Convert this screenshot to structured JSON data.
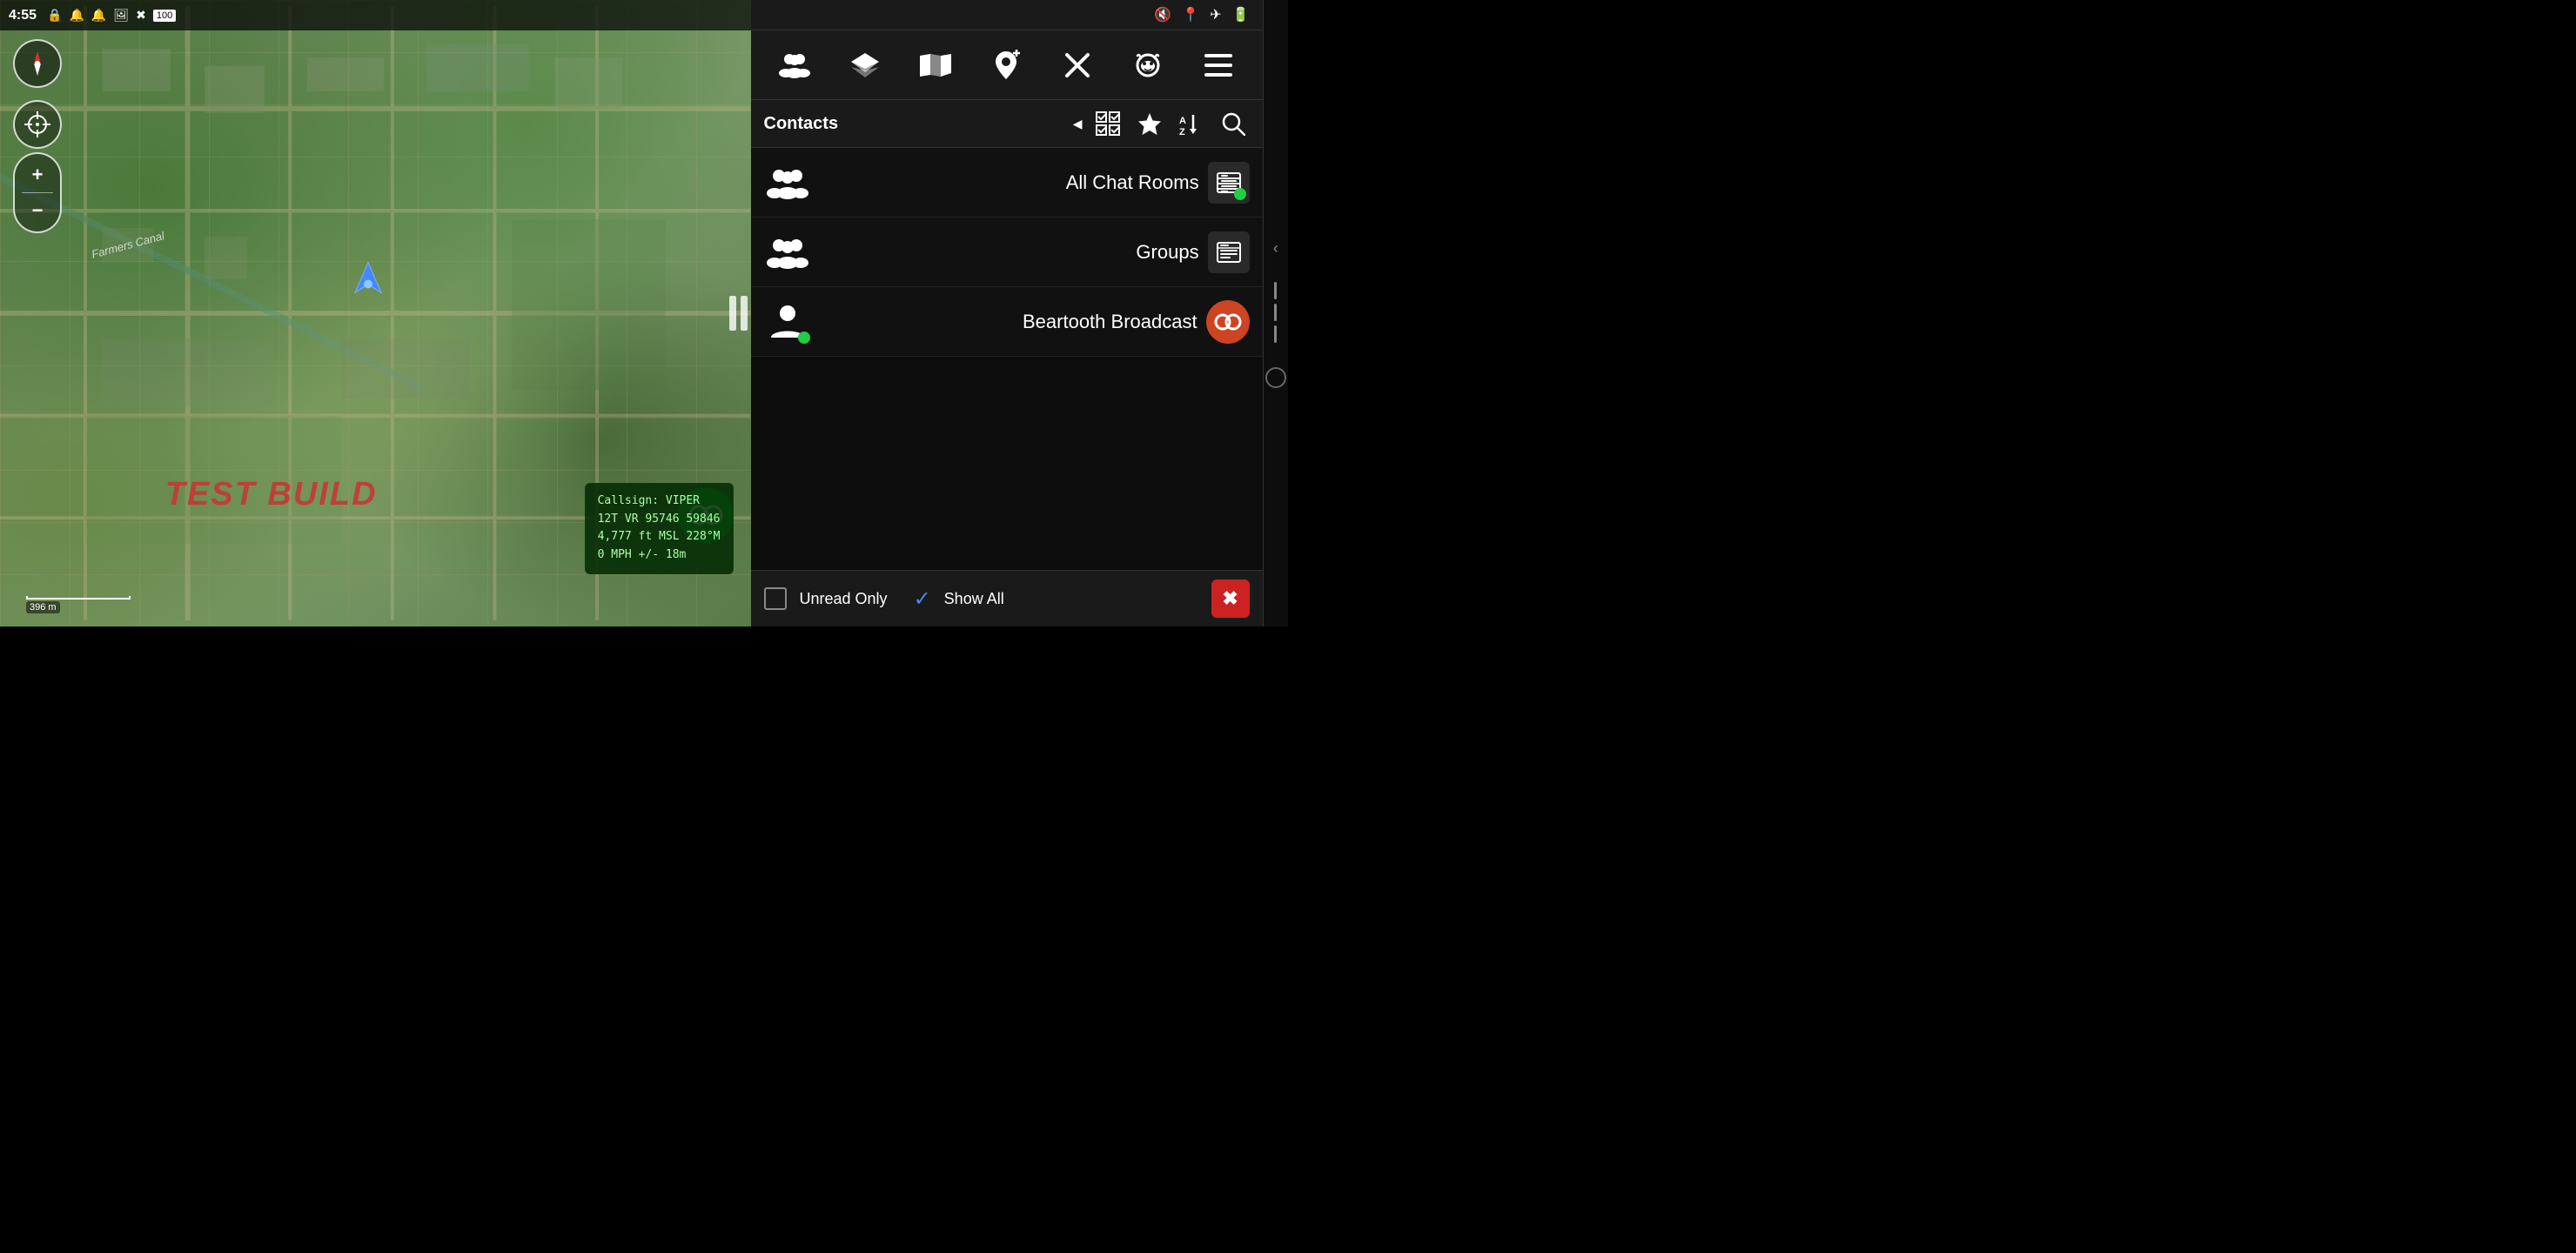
{
  "statusBar": {
    "time": "4:55",
    "icons": [
      "🔔",
      "🔔",
      "🖼",
      "✖",
      "🔋"
    ]
  },
  "statusBarRight": {
    "icons": [
      "🔇",
      "📍",
      "✈",
      "🔋"
    ]
  },
  "map": {
    "farmersCanal": "Farmers Canal",
    "testBuild": "TEST BUILD",
    "scaleLabel": "396 m",
    "callsign": {
      "line1": "Callsign: VIPER",
      "line2": "12T  VR  95746  59846",
      "line3": "4,777 ft MSL      228°M",
      "line4": "0 MPH            +/- 18m"
    }
  },
  "toolbar": {
    "icons": [
      {
        "name": "people-icon",
        "symbol": "👥"
      },
      {
        "name": "layers-icon",
        "symbol": "◈"
      },
      {
        "name": "map-icon",
        "symbol": "🗺"
      },
      {
        "name": "location-add-icon",
        "symbol": "📍"
      },
      {
        "name": "close-icon",
        "symbol": "✖"
      },
      {
        "name": "dog-icon",
        "symbol": "🐕"
      },
      {
        "name": "menu-icon",
        "symbol": "≡"
      }
    ]
  },
  "contactsHeader": {
    "title": "Contacts",
    "arrow": "◀"
  },
  "contacts": [
    {
      "name": "All Chat Rooms",
      "hasGreenDot": true,
      "actionIcon": "chat-rooms-icon"
    },
    {
      "name": "Groups",
      "hasGreenDot": false,
      "actionIcon": "groups-icon"
    },
    {
      "name": "Beartooth Broadcast",
      "hasGreenDot": true,
      "actionIcon": "broadcast-icon",
      "actionColor": "#cc4422"
    }
  ],
  "bottomBar": {
    "unreadLabel": "Unread Only",
    "showAllLabel": "Show All",
    "closeIcon": "✖"
  }
}
